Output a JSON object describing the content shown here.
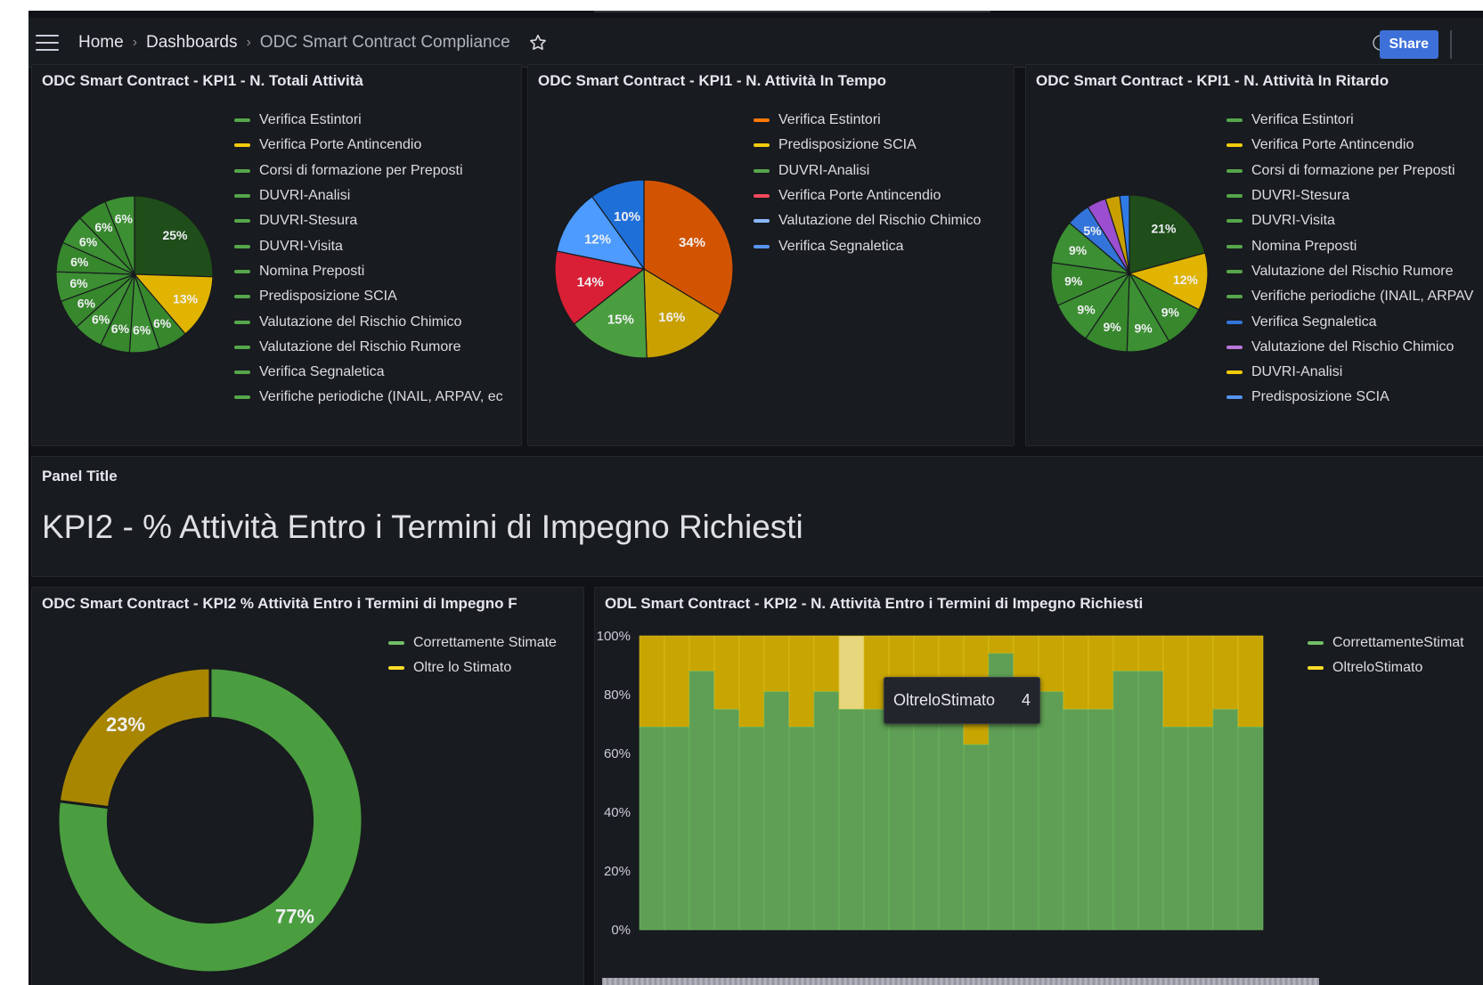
{
  "topbar": {
    "breadcrumbs": [
      "Home",
      "Dashboards",
      "ODC Smart Contract Compliance"
    ],
    "share_label": "Share"
  },
  "panels": {
    "kpi1_total": {
      "title": "ODC Smart Contract - KPI1 - N. Totali Attività",
      "legend": [
        {
          "label": "Verifica Estintori",
          "color": "#56a64b"
        },
        {
          "label": "Verifica Porte Antincendio",
          "color": "#f2cc0c"
        },
        {
          "label": "Corsi di formazione per Preposti",
          "color": "#56a64b"
        },
        {
          "label": "DUVRI-Analisi",
          "color": "#56a64b"
        },
        {
          "label": "DUVRI-Stesura",
          "color": "#56a64b"
        },
        {
          "label": "DUVRI-Visita",
          "color": "#56a64b"
        },
        {
          "label": "Nomina Preposti",
          "color": "#56a64b"
        },
        {
          "label": "Predisposizione SCIA",
          "color": "#56a64b"
        },
        {
          "label": "Valutazione del Rischio Chimico",
          "color": "#56a64b"
        },
        {
          "label": "Valutazione del Rischio Rumore",
          "color": "#56a64b"
        },
        {
          "label": "Verifica Segnaletica",
          "color": "#56a64b"
        },
        {
          "label": "Verifiche periodiche (INAIL, ARPAV, ec",
          "color": "#56a64b"
        }
      ]
    },
    "kpi1_in_time": {
      "title": "ODC Smart Contract - KPI1 - N. Attività In Tempo",
      "legend": [
        {
          "label": "Verifica Estintori",
          "color": "#ff780a"
        },
        {
          "label": "Predisposizione SCIA",
          "color": "#f2cc0c"
        },
        {
          "label": "DUVRI-Analisi",
          "color": "#56a64b"
        },
        {
          "label": "Verifica Porte Antincendio",
          "color": "#f2495c"
        },
        {
          "label": "Valutazione del Rischio Chimico",
          "color": "#8ab8ff"
        },
        {
          "label": "Verifica Segnaletica",
          "color": "#5794f2"
        }
      ]
    },
    "kpi1_late": {
      "title": "ODC Smart Contract - KPI1 - N. Attività In Ritardo",
      "legend": [
        {
          "label": "Verifica Estintori",
          "color": "#56a64b"
        },
        {
          "label": "Verifica Porte Antincendio",
          "color": "#f2cc0c"
        },
        {
          "label": "Corsi di formazione per Preposti",
          "color": "#56a64b"
        },
        {
          "label": "DUVRI-Stesura",
          "color": "#56a64b"
        },
        {
          "label": "DUVRI-Visita",
          "color": "#56a64b"
        },
        {
          "label": "Nomina Preposti",
          "color": "#56a64b"
        },
        {
          "label": "Valutazione del Rischio Rumore",
          "color": "#56a64b"
        },
        {
          "label": "Verifiche periodiche (INAIL, ARPAV",
          "color": "#56a64b"
        },
        {
          "label": "Verifica Segnaletica",
          "color": "#3274d9"
        },
        {
          "label": "Valutazione del Rischio Chimico",
          "color": "#b877d9"
        },
        {
          "label": "DUVRI-Analisi",
          "color": "#f2cc0c"
        },
        {
          "label": "Predisposizione SCIA",
          "color": "#5794f2"
        }
      ]
    },
    "text_panel": {
      "header": "Panel Title",
      "content": "KPI2 - % Attività Entro i Termini di Impegno Richiesti"
    },
    "kpi2_pct": {
      "title": "ODC Smart Contract - KPI2 % Attività Entro i Termini di Impegno F",
      "legend": [
        {
          "label": "Correttamente Stimate",
          "color": "#73bf69"
        },
        {
          "label": "Oltre lo Stimato",
          "color": "#fade2a"
        }
      ]
    },
    "kpi2_count": {
      "title": "ODL Smart Contract - KPI2 - N. Attività Entro i Termini di Impegno Richiesti",
      "legend": [
        {
          "label": "CorrettamenteStimat",
          "color": "#73bf69"
        },
        {
          "label": "OltreloStimato",
          "color": "#fade2a"
        }
      ],
      "tooltip": {
        "label": "OltreloStimato",
        "value": "4"
      }
    }
  },
  "chart_data": [
    {
      "type": "pie",
      "title": "ODC Smart Contract - KPI1 - N. Totali Attività",
      "values": [
        25,
        13,
        6,
        6,
        6,
        6,
        6,
        6,
        6,
        6,
        6,
        6
      ],
      "labels": [
        "25%",
        "13%",
        "6%",
        "6%",
        "6%",
        "6%",
        "6%",
        "6%",
        "6%",
        "6%",
        "6%",
        "6%"
      ],
      "colors": [
        "#1f4e1a",
        "#e0b400",
        "#37872d",
        "#3c8f32",
        "#37872d",
        "#3c8f32",
        "#37872d",
        "#3c8f32",
        "#37872d",
        "#3c8f32",
        "#37872d",
        "#3c8f32"
      ]
    },
    {
      "type": "pie",
      "title": "ODC Smart Contract - KPI1 - N. Attività In Tempo",
      "values": [
        34,
        16,
        15,
        14,
        12,
        10
      ],
      "labels": [
        "34%",
        "16%",
        "15%",
        "14%",
        "12%",
        "10%"
      ],
      "colors": [
        "#d35400",
        "#c9a000",
        "#4a9e3f",
        "#d81f35",
        "#4d9bff",
        "#1f6fd9"
      ]
    },
    {
      "type": "pie",
      "title": "ODC Smart Contract - KPI1 - N. Attività In Ritardo",
      "values": [
        21,
        12,
        9,
        9,
        9,
        9,
        9,
        9,
        5,
        4,
        3,
        2
      ],
      "labels": [
        "21%",
        "12%",
        "9%",
        "9%",
        "9%",
        "9%",
        "9%",
        "9%",
        "5%",
        "",
        "",
        ""
      ],
      "colors": [
        "#1f4e1a",
        "#e0b400",
        "#37872d",
        "#3c8f32",
        "#37872d",
        "#3c8f32",
        "#37872d",
        "#3c8f32",
        "#3274d9",
        "#9b4fd0",
        "#c9a000",
        "#2f7be6"
      ]
    },
    {
      "type": "pie",
      "title": "ODC Smart Contract - KPI2 % Attività Entro i Termini di Impegno F",
      "values": [
        77,
        23
      ],
      "labels": [
        "77%",
        "23%"
      ],
      "colors": [
        "#4a9e3f",
        "#a88600"
      ]
    },
    {
      "type": "bar",
      "title": "ODL Smart Contract - KPI2 - N. Attività Entro i Termini di Impegno Richiesti",
      "y_ticks": [
        "0%",
        "20%",
        "40%",
        "60%",
        "80%",
        "100%"
      ],
      "ylim": [
        0,
        100
      ],
      "series": [
        {
          "name": "CorrettamenteStimat",
          "values": [
            69,
            69,
            88,
            75,
            69,
            81,
            69,
            81,
            75,
            75,
            75,
            75,
            75,
            63,
            94,
            81,
            81,
            75,
            75,
            88,
            88,
            69,
            69,
            75,
            69
          ]
        },
        {
          "name": "OltreloStimato",
          "values": [
            31,
            31,
            12,
            25,
            31,
            19,
            31,
            19,
            25,
            25,
            25,
            25,
            25,
            37,
            6,
            19,
            19,
            25,
            25,
            12,
            12,
            31,
            31,
            25,
            31
          ]
        }
      ]
    }
  ]
}
